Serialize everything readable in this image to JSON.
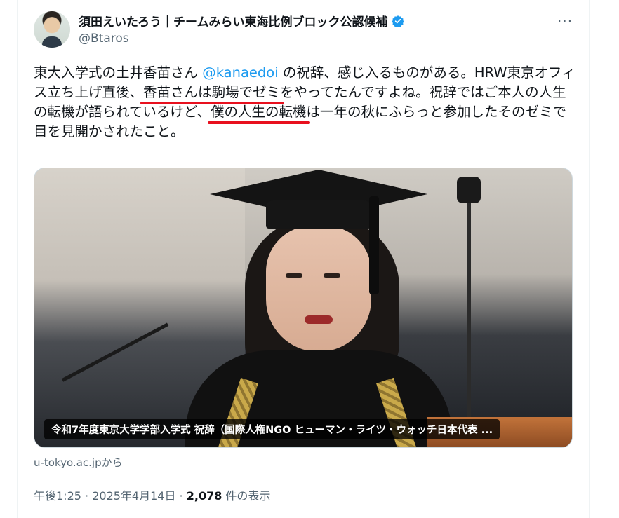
{
  "author": {
    "display_name": "須田えいたろう｜チームみらい東海比例ブロック公認候補",
    "handle": "@Btaros",
    "verified_icon": "verified-badge-icon",
    "verified_color": "#1d9bf0"
  },
  "more_icon": "···",
  "tweet": {
    "seg1": "東大入学式の土井香苗さん ",
    "mention": "@kanaedoi",
    "seg2": " の祝辞、感じ入るものがある。HRW東京オフィス立ち上げ直後、",
    "highlight1": "香苗さんは駒場でゼミ",
    "seg3": "をやってたんですよね。祝辞ではご本人の人生の転機が語られているけど、",
    "highlight2": "僕の人生の転機",
    "seg4": "は一年の秋にふらっと参加したそのゼミで目を見開かされたこと。"
  },
  "media": {
    "caption": "令和7年度東京大学学部入学式 祝辞（国際人権NGO ヒューマン・ライツ・ウォッチ日本代表 ..."
  },
  "link_source": "u-tokyo.ac.jpから",
  "meta": {
    "time": "午後1:25",
    "sep1": " · ",
    "date": "2025年4月14日",
    "sep2": " · ",
    "views_count": "2,078",
    "views_label": " 件の表示"
  },
  "colors": {
    "accent": "#1d9bf0",
    "underline": "#e8101e",
    "secondary_text": "#536471"
  }
}
